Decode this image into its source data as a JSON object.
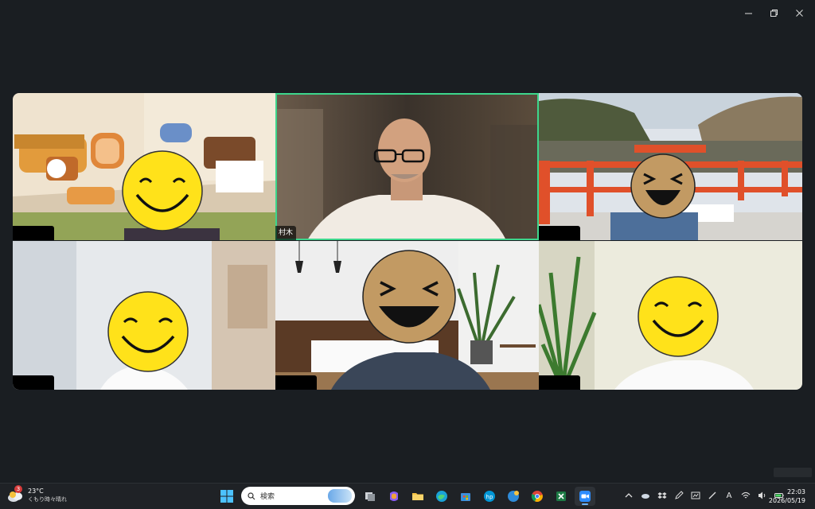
{
  "window": {
    "controls": [
      {
        "name": "minimize",
        "icon": "minimize-icon"
      },
      {
        "name": "restore",
        "icon": "restore-icon"
      },
      {
        "name": "close",
        "icon": "close-icon"
      }
    ]
  },
  "meeting": {
    "active_speaker_color": "#3dd68c",
    "participants": [
      {
        "label": "",
        "redacted": true,
        "scene": "toy-room"
      },
      {
        "label": "村木",
        "redacted": false,
        "active": true,
        "scene": "blurred-room"
      },
      {
        "label": "",
        "redacted": true,
        "scene": "red-bridge"
      },
      {
        "label": "",
        "redacted": true,
        "scene": "bright-wall"
      },
      {
        "label": "",
        "redacted": true,
        "scene": "living-room"
      },
      {
        "label": "",
        "redacted": true,
        "scene": "plant-wall"
      }
    ]
  },
  "taskbar": {
    "weather": {
      "badge": "3",
      "temperature": "23°C",
      "condition": "くもり時々晴れ"
    },
    "search": {
      "placeholder": "検索"
    },
    "apps": [
      {
        "name": "task-view",
        "icon": "task-view-icon"
      },
      {
        "name": "copilot",
        "icon": "copilot-icon"
      },
      {
        "name": "file-explorer",
        "icon": "folder-icon"
      },
      {
        "name": "edge",
        "icon": "edge-icon"
      },
      {
        "name": "store",
        "icon": "store-icon"
      },
      {
        "name": "hp",
        "icon": "hp-icon"
      },
      {
        "name": "app-g",
        "icon": "g-app-icon"
      },
      {
        "name": "chrome",
        "icon": "chrome-icon"
      },
      {
        "name": "excel",
        "icon": "excel-icon"
      },
      {
        "name": "zoom",
        "icon": "zoom-icon",
        "running": true
      }
    ],
    "clock": {
      "time": "22:03",
      "date": "2026/05/19"
    },
    "ime": "A"
  }
}
